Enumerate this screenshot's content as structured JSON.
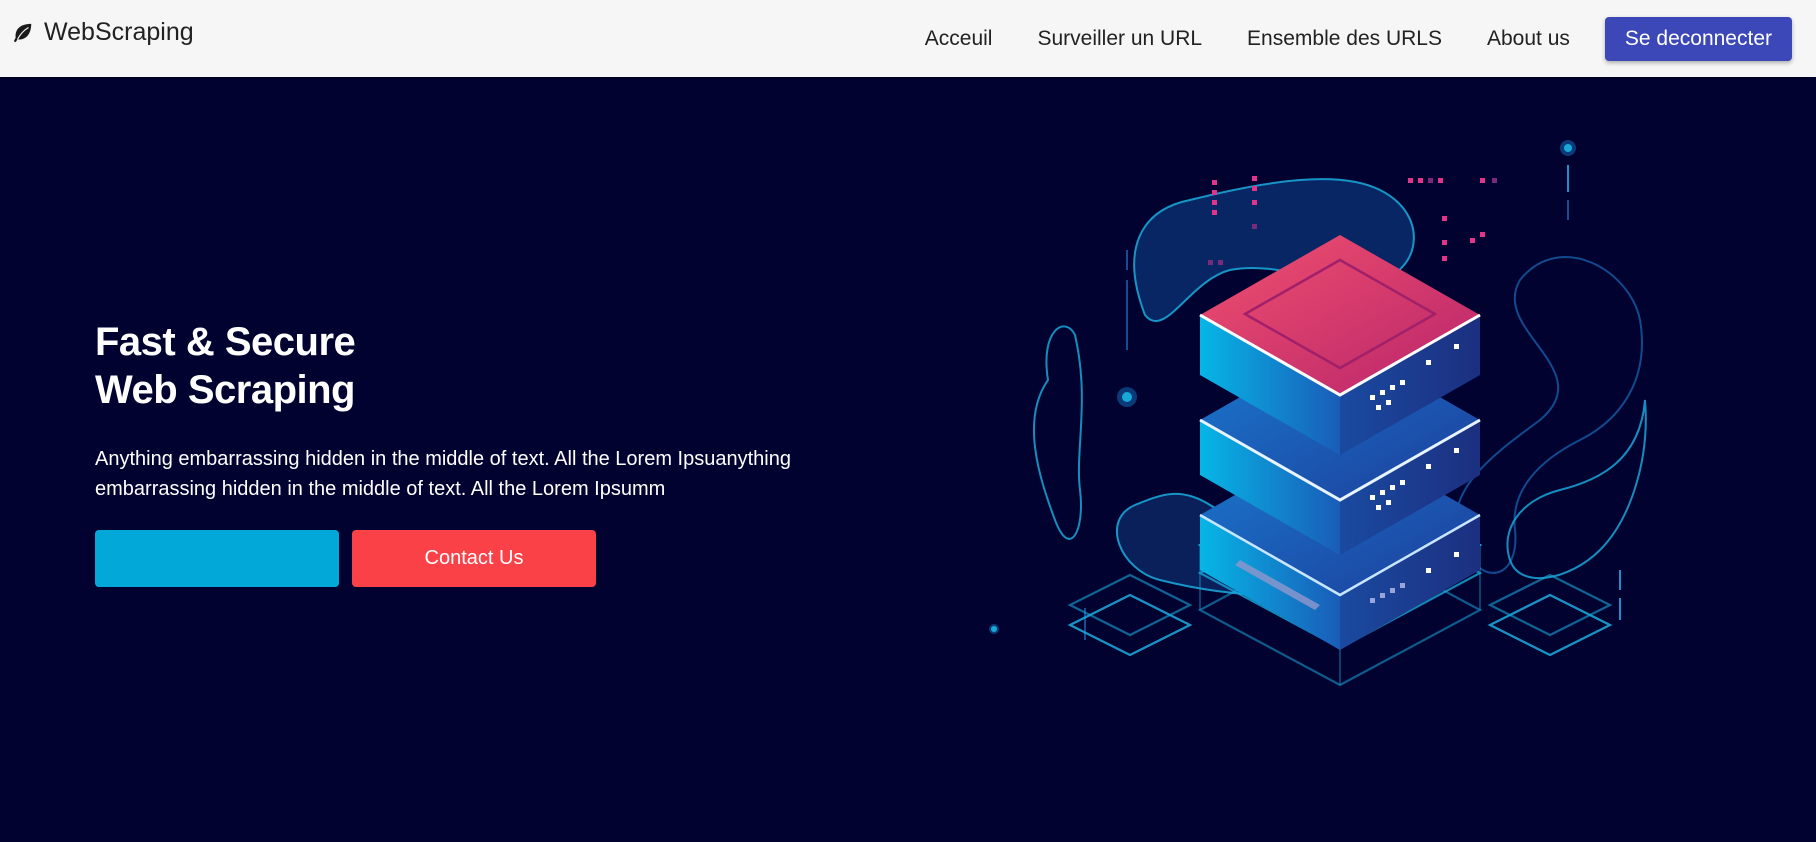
{
  "navbar": {
    "brand_name": "WebScraping",
    "brand_icon": "leaf-icon",
    "links": [
      {
        "label": "Acceuil"
      },
      {
        "label": "Surveiller un URL"
      },
      {
        "label": "Ensemble des URLS"
      },
      {
        "label": "About us"
      }
    ],
    "logout_label": "Se deconnecter"
  },
  "hero": {
    "title_line1": "Fast & Secure",
    "title_line2": "Web Scraping",
    "description": "Anything embarrassing hidden in the middle of text. All the Lorem Ipsuanything embarrassing hidden in the middle of text. All the Lorem Ipsumm",
    "primary_button_label": "",
    "contact_button_label": "Contact Us",
    "illustration": "server-stack-illustration"
  },
  "colors": {
    "navbar_bg": "#f6f6f6",
    "hero_bg": "#010230",
    "logout_button": "#3c47b8",
    "primary_button": "#02a8d8",
    "contact_button": "#fa4148"
  }
}
